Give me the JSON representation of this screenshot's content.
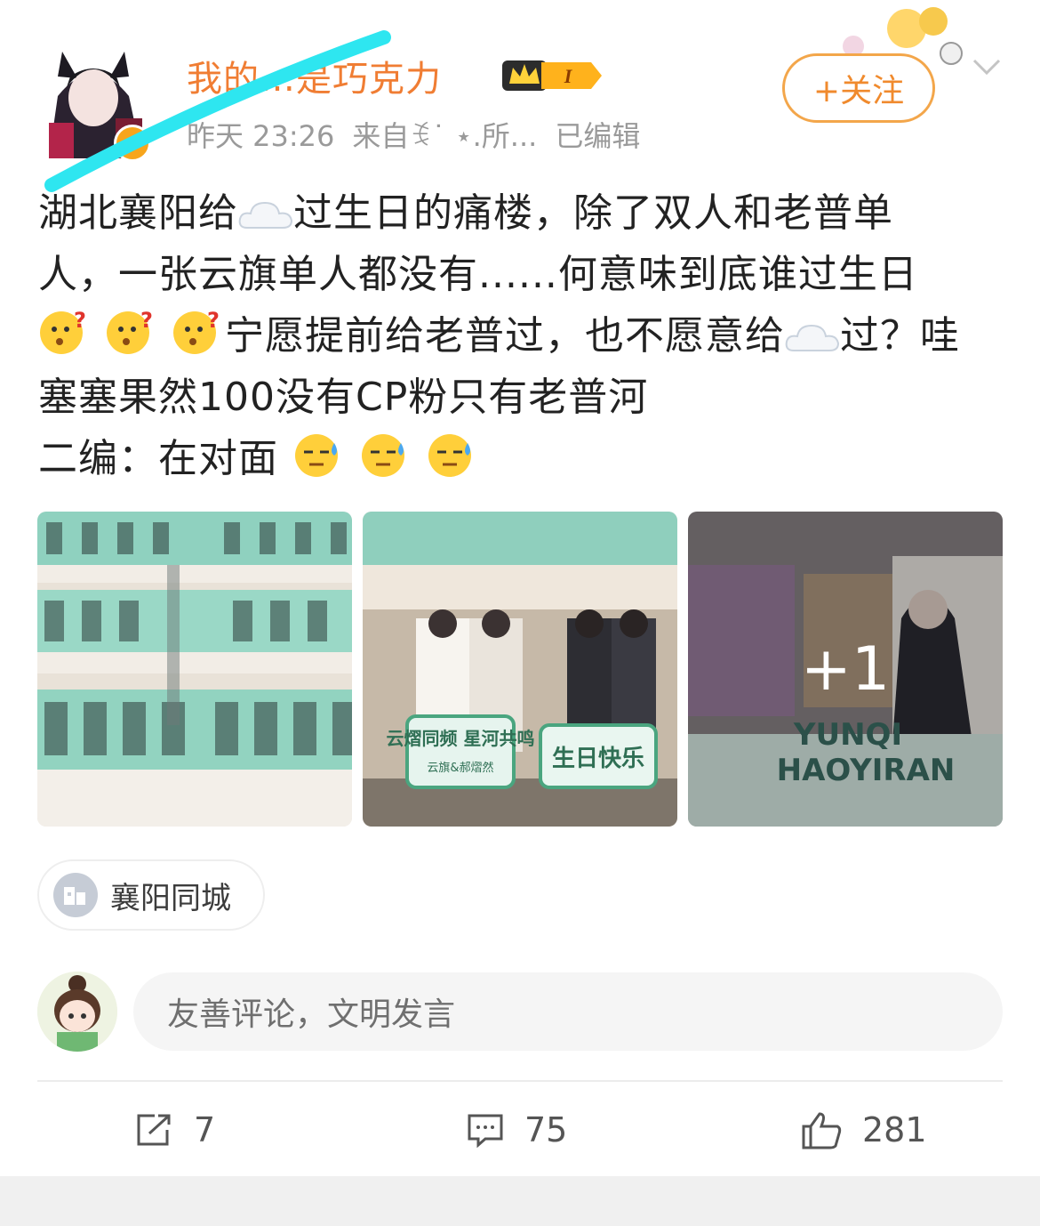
{
  "post": {
    "author": {
      "name": "我的…是巧克力",
      "vip_level": "I",
      "avatar_icon": "user-avatar"
    },
    "meta": {
      "time": "昨天 23:26",
      "source": "来自ꉂ˙ ⋆.所...",
      "edited": "已编辑"
    },
    "follow_label": "+关注",
    "text_lines": {
      "l1a": "湖北襄阳给",
      "l1b": "过生日的痛楼，除了双人和老普单",
      "l2": "人，一张云旗单人都没有......何意味到底谁过生日",
      "l3a": "宁愿提前给老普过，也不愿意给",
      "l3b": "过？哇",
      "l4": "塞塞果然100没有CP粉只有老普河",
      "l5": "二编：在对面"
    },
    "images": {
      "more_count": "+1",
      "img2_sign_left": "云熠同频 星河共鸣",
      "img2_sign_left_sub": "云旗&郝熠然",
      "img2_sign_right": "生日快乐",
      "img3_banner_1": "YUNQI",
      "img3_banner_2": "HAOYIRAN"
    },
    "topic": {
      "label": "襄阳同城",
      "icon": "city-building-icon"
    }
  },
  "comment_box": {
    "placeholder": "友善评论，文明发言"
  },
  "actions": {
    "repost_count": "7",
    "comment_count": "75",
    "like_count": "281"
  },
  "colors": {
    "accent_orange": "#f08a2d",
    "meta_gray": "#9a9a9a",
    "scribble_cyan": "#2ee6f0"
  }
}
